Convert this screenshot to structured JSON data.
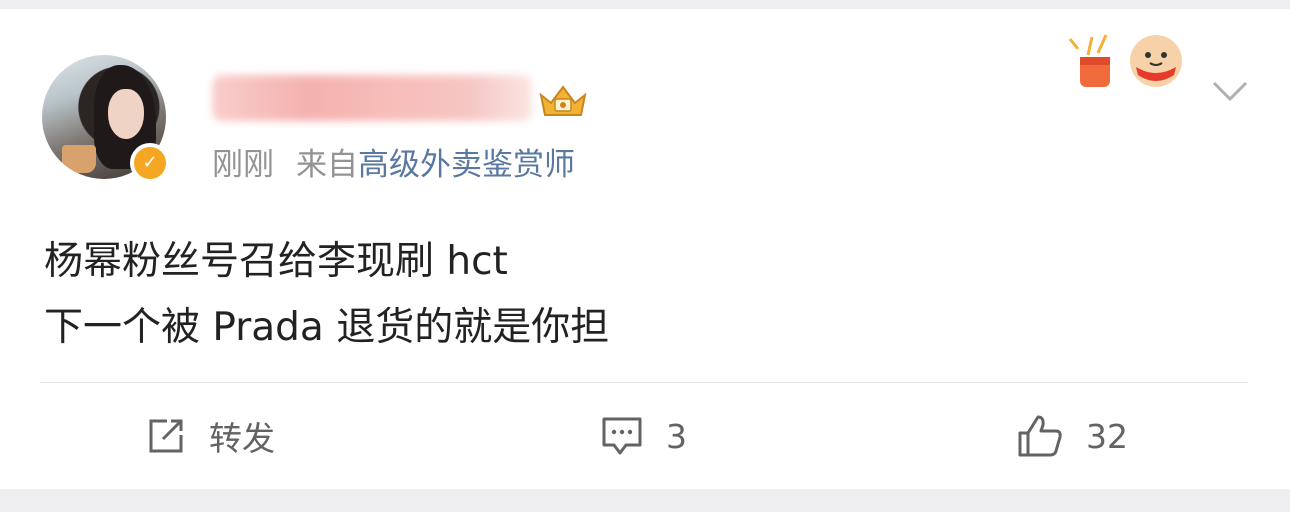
{
  "post": {
    "time": "刚刚",
    "source_prefix": "来自",
    "source_name": "高级外卖鉴赏师",
    "content_line1": "杨幂粉丝号召给李现刷 hct",
    "content_line2": "下一个被 Prada 退货的就是你担"
  },
  "actions": {
    "repost_label": "转发",
    "comment_count": "3",
    "like_count": "32"
  },
  "icons": {
    "more": "chevron-down-icon",
    "repost": "edit-share-icon",
    "comment": "comment-icon",
    "like": "thumbs-up-icon",
    "verified": "verified-badge-icon",
    "vip": "vip-crown-icon"
  },
  "colors": {
    "verified": "#f5a623",
    "source_link": "#5a78a0",
    "meta_text": "#939393",
    "content_text": "#222222"
  }
}
